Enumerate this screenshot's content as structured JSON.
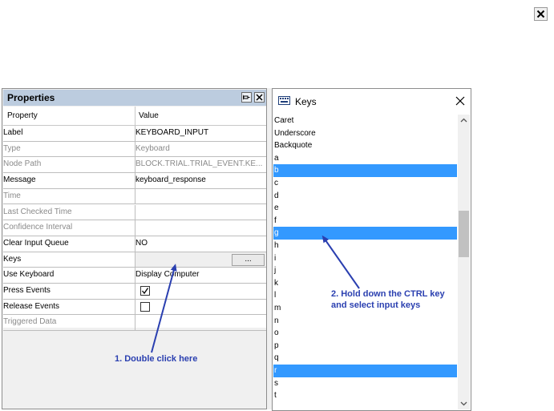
{
  "properties_panel": {
    "title": "Properties",
    "header": {
      "property": "Property",
      "value": "Value"
    },
    "rows": [
      {
        "name": "Label",
        "value": "KEYBOARD_INPUT",
        "disabled": false
      },
      {
        "name": "Type",
        "value": "Keyboard",
        "disabled": true
      },
      {
        "name": "Node Path",
        "value": "BLOCK.TRIAL.TRIAL_EVENT.KE...",
        "disabled": true
      },
      {
        "name": "Message",
        "value": "keyboard_response",
        "disabled": false
      },
      {
        "name": "Time",
        "value": "",
        "disabled": true
      },
      {
        "name": "Last Checked Time",
        "value": "",
        "disabled": true
      },
      {
        "name": "Confidence Interval",
        "value": "",
        "disabled": true
      },
      {
        "name": "Clear Input Queue",
        "value": "NO",
        "disabled": false
      },
      {
        "name": "Keys",
        "value": "",
        "disabled": false
      },
      {
        "name": "Use Keyboard",
        "value": "Display Computer",
        "disabled": false
      },
      {
        "name": "Press Events",
        "value": "",
        "disabled": false
      },
      {
        "name": "Release Events",
        "value": "",
        "disabled": false
      },
      {
        "name": "Triggered Data",
        "value": "",
        "disabled": true
      }
    ],
    "keys_button_label": "...",
    "press_events_checked": true,
    "release_events_checked": false
  },
  "keys_panel": {
    "title": "Keys",
    "items": [
      "Caret",
      "Underscore",
      "Backquote",
      "a",
      "b",
      "c",
      "d",
      "e",
      "f",
      "g",
      "h",
      "i",
      "j",
      "k",
      "l",
      "m",
      "n",
      "o",
      "p",
      "q",
      "r",
      "s",
      "t"
    ],
    "selected": [
      "b",
      "g",
      "r"
    ]
  },
  "annotations": {
    "step1": "1. Double click here",
    "step2_line1": "2. Hold down the CTRL key",
    "step2_line2": "and select input keys"
  },
  "colors": {
    "selection": "#3399ff",
    "annotation": "#2a3fb0",
    "title_bar": "#bcccdf"
  }
}
